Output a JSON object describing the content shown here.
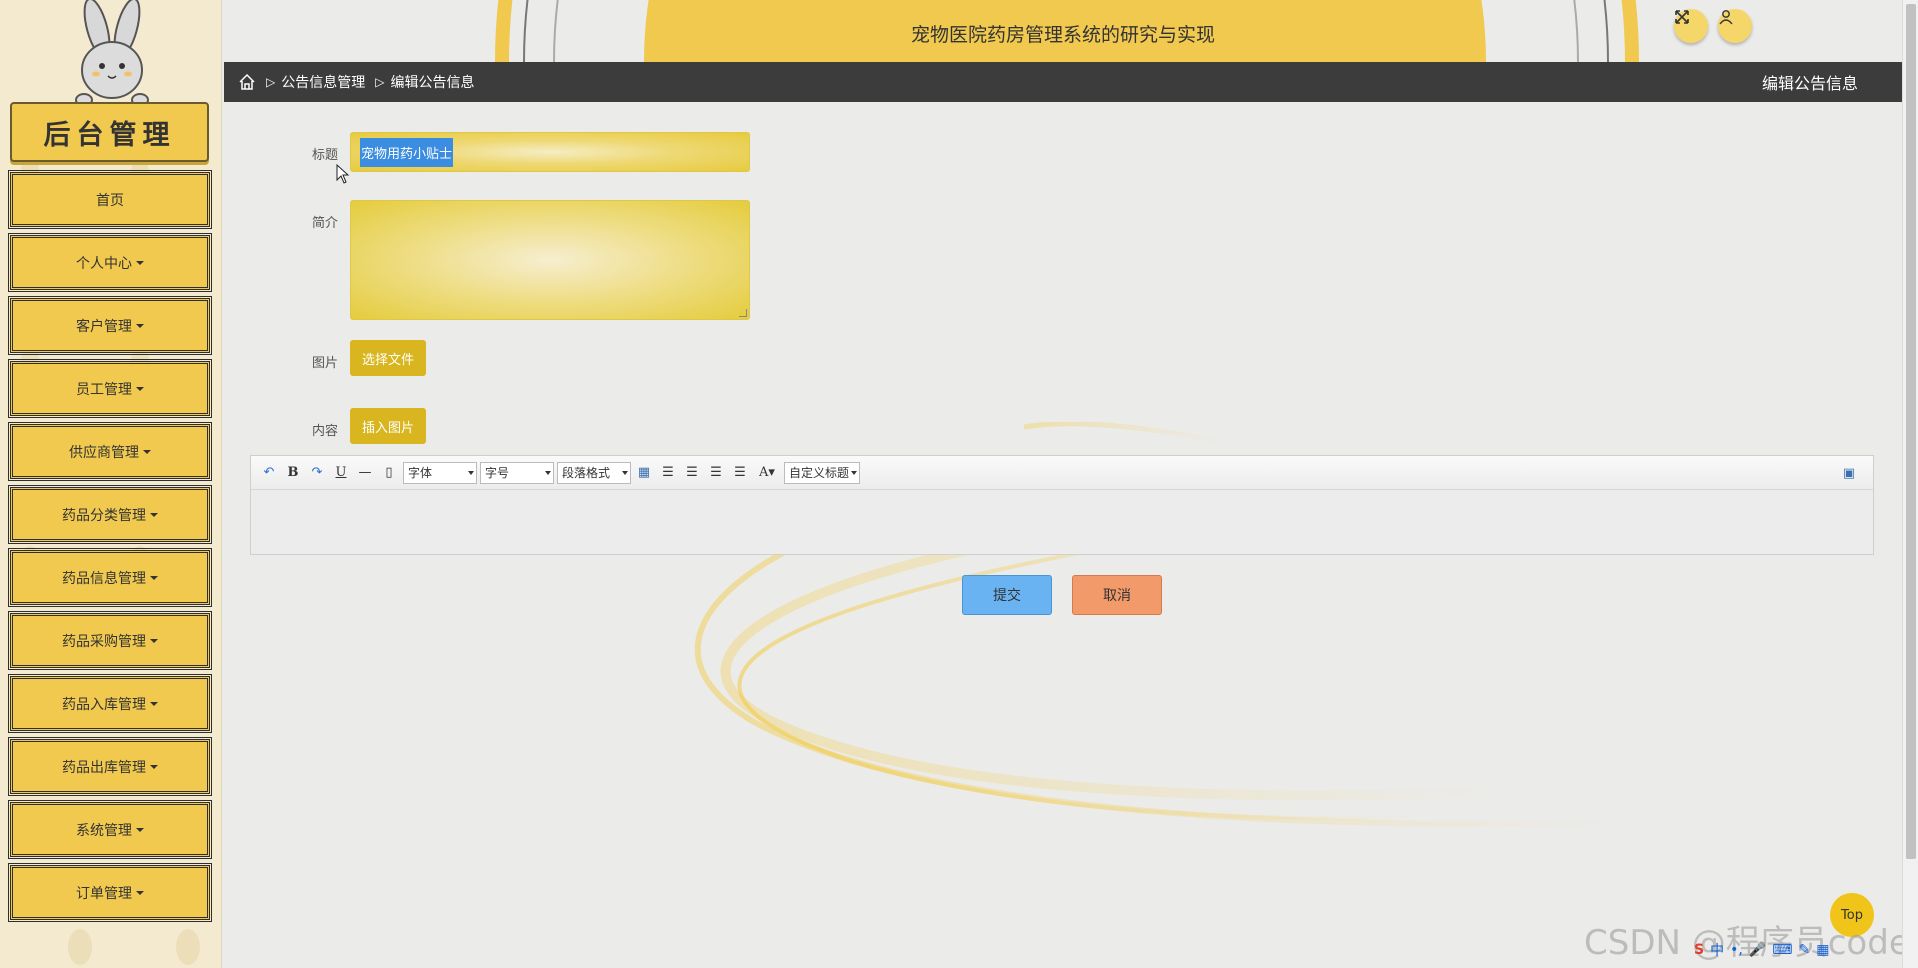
{
  "sidebar": {
    "logo_text": "后台管理",
    "items": [
      {
        "label": "首页",
        "has_caret": false
      },
      {
        "label": "个人中心",
        "has_caret": true
      },
      {
        "label": "客户管理",
        "has_caret": true
      },
      {
        "label": "员工管理",
        "has_caret": true
      },
      {
        "label": "供应商管理",
        "has_caret": true
      },
      {
        "label": "药品分类管理",
        "has_caret": true
      },
      {
        "label": "药品信息管理",
        "has_caret": true
      },
      {
        "label": "药品采购管理",
        "has_caret": true
      },
      {
        "label": "药品入库管理",
        "has_caret": true
      },
      {
        "label": "药品出库管理",
        "has_caret": true
      },
      {
        "label": "系统管理",
        "has_caret": true
      },
      {
        "label": "订单管理",
        "has_caret": true
      }
    ]
  },
  "header": {
    "title": "宠物医院药房管理系统的研究与实现",
    "fullscreen_icon": "expand-icon",
    "user_icon": "user-icon"
  },
  "breadcrumb": {
    "home_icon": "home-icon",
    "separator": "▷",
    "items": [
      "公告信息管理",
      "编辑公告信息"
    ],
    "page_name": "编辑公告信息"
  },
  "form": {
    "title_label": "标题",
    "title_value": "宠物用药小贴士",
    "intro_label": "简介",
    "intro_value": "",
    "image_label": "图片",
    "choose_file_label": "选择文件",
    "content_label": "内容",
    "insert_image_label": "插入图片",
    "editor": {
      "font_select": "字体",
      "size_select": "字号",
      "paragraph_select": "段落格式",
      "custom_title_select": "自定义标题",
      "text_color_icon": "A"
    },
    "submit_label": "提交",
    "cancel_label": "取消"
  },
  "top_button_label": "Top",
  "watermark_text": "CSDN @程序员code",
  "colors": {
    "accent_yellow": "#f0c94e",
    "crumb_bar": "#3c3c3c",
    "submit": "#69b3f2",
    "cancel": "#f39a6b"
  }
}
